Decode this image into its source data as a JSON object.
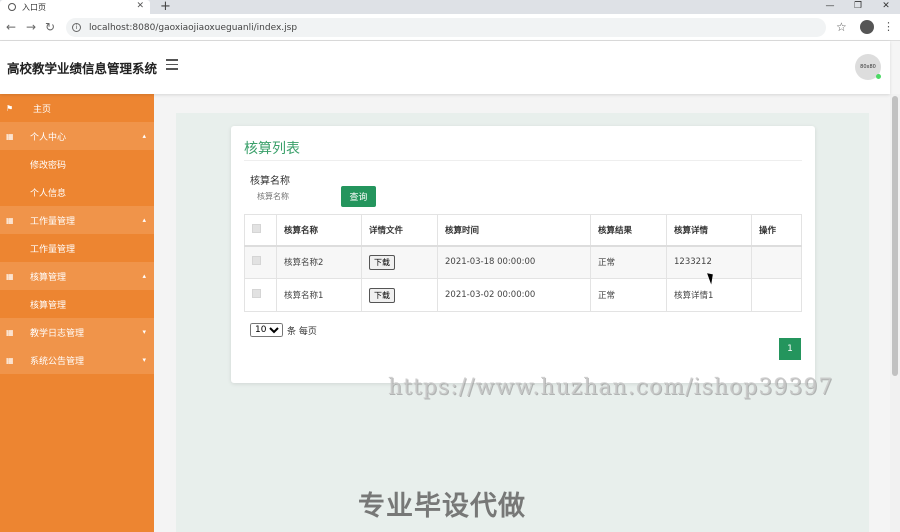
{
  "browser": {
    "tab_title": "入口页",
    "url": "localhost:8080/gaoxiaojiaoxueguanli/index.jsp"
  },
  "header": {
    "app_title": "高校教学业绩信息管理系统",
    "avatar_text": "80x80"
  },
  "sidebar": {
    "items": [
      {
        "label": "主页",
        "type": "group",
        "icon": "flag-icon"
      },
      {
        "label": "个人中心",
        "type": "group",
        "icon": "grid-icon",
        "expanded": true
      },
      {
        "label": "修改密码",
        "type": "sub"
      },
      {
        "label": "个人信息",
        "type": "sub"
      },
      {
        "label": "工作量管理",
        "type": "group",
        "icon": "grid-icon",
        "expanded": true
      },
      {
        "label": "工作量管理",
        "type": "sub"
      },
      {
        "label": "核算管理",
        "type": "group",
        "icon": "grid-icon",
        "expanded": true
      },
      {
        "label": "核算管理",
        "type": "sub"
      },
      {
        "label": "教学日志管理",
        "type": "group",
        "icon": "grid-icon",
        "expanded": false
      },
      {
        "label": "系统公告管理",
        "type": "group",
        "icon": "grid-icon",
        "expanded": false
      }
    ]
  },
  "main": {
    "title": "核算列表",
    "search": {
      "label": "核算名称",
      "placeholder": "核算名称",
      "button": "查询"
    },
    "table": {
      "headers": [
        "核算名称",
        "详情文件",
        "核算时间",
        "核算结果",
        "核算详情",
        "操作"
      ],
      "rows": [
        {
          "name": "核算名称2",
          "file_btn": "下载",
          "time": "2021-03-18 00:00:00",
          "result": "正常",
          "detail": "1233212",
          "action": ""
        },
        {
          "name": "核算名称1",
          "file_btn": "下载",
          "time": "2021-03-02 00:00:00",
          "result": "正常",
          "detail": "核算详情1",
          "action": ""
        }
      ]
    },
    "pagination": {
      "page_size": "10",
      "page_size_options": [
        "10"
      ],
      "per_page_label": "条 每页",
      "current_page": "1"
    }
  },
  "watermarks": {
    "url": "https://www.huzhan.com/ishop39397",
    "cn": "专业毕设代做"
  },
  "colors": {
    "sidebar": "#ed8531",
    "accent": "#24955d",
    "title": "#3aa06a"
  }
}
